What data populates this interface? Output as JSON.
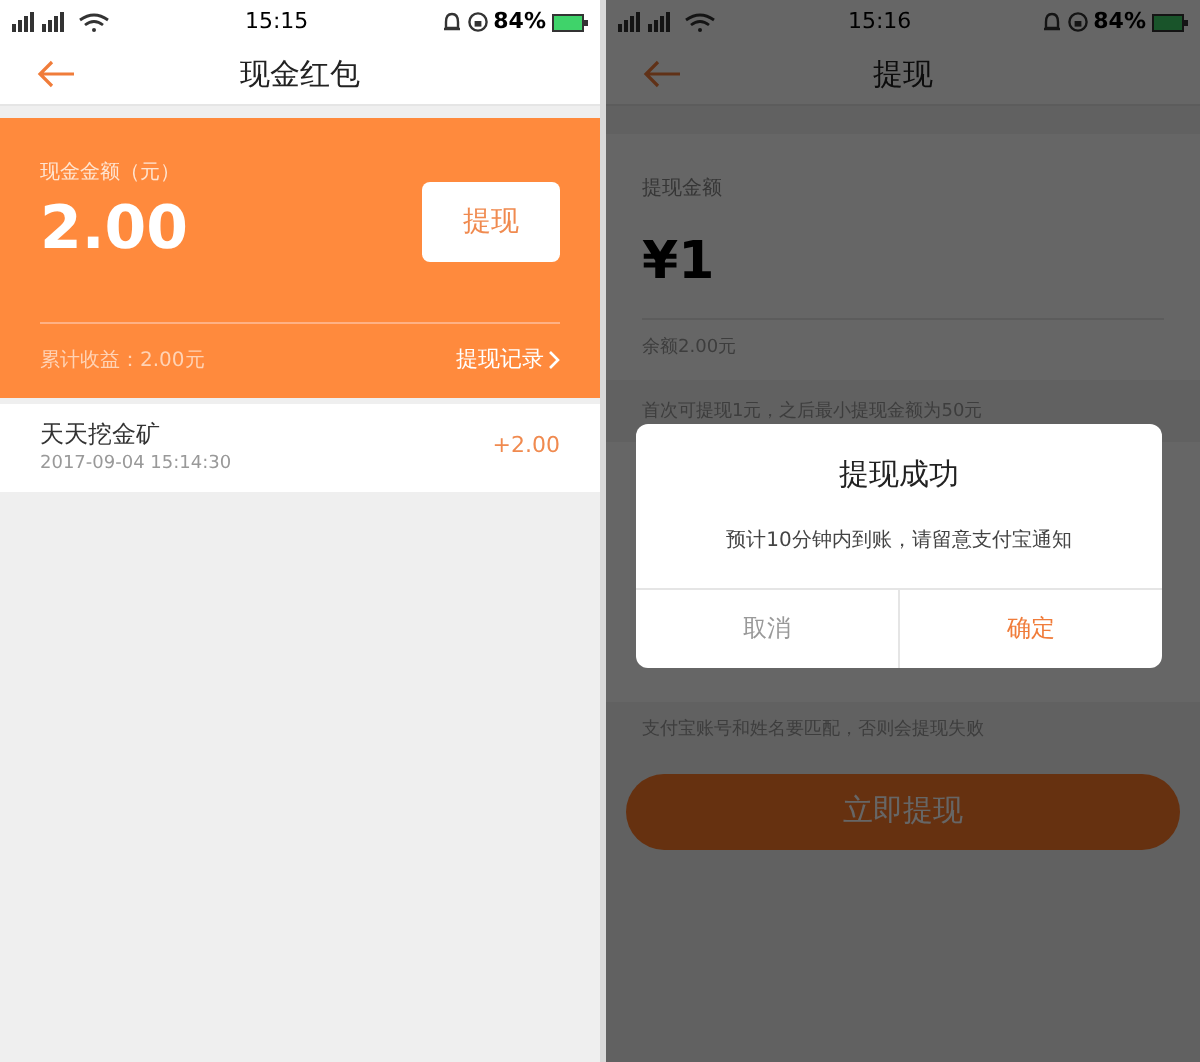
{
  "left_screen": {
    "status_bar": {
      "time": "15:15",
      "battery": "84%"
    },
    "title": "现金红包",
    "balance_card": {
      "label": "现金金额（元）",
      "amount": "2.00",
      "withdraw_button": "提现",
      "earnings": "累计收益：2.00元",
      "records_link": "提现记录"
    },
    "records": [
      {
        "name": "天天挖金矿",
        "time": "2017-09-04 15:14:30",
        "amount": "+2.00"
      }
    ]
  },
  "right_screen": {
    "status_bar": {
      "time": "15:16",
      "battery": "84%"
    },
    "title": "提现",
    "amount_label": "提现金额",
    "amount": "¥1",
    "balance": "余额2.00元",
    "note": "首次可提现1元，之后最小提现金额为50元",
    "hint": "支付宝账号和姓名要匹配，否则会提现失败",
    "submit_button": "立即提现",
    "dialog": {
      "title": "提现成功",
      "message": "预计10分钟内到账，请留意支付宝通知",
      "cancel": "取消",
      "confirm": "确定"
    }
  }
}
